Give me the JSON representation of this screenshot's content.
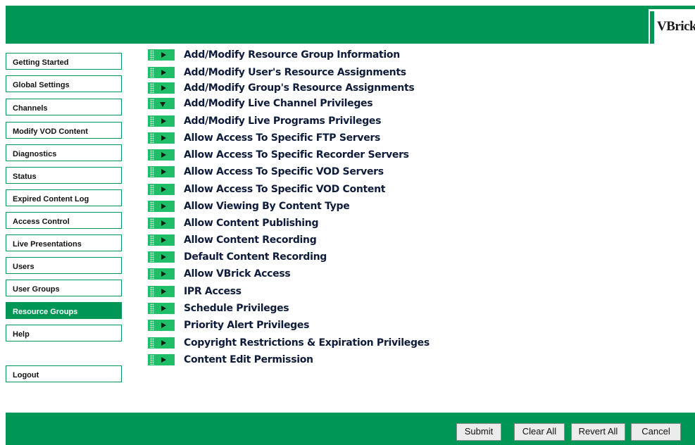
{
  "logo": {
    "text": "VBrick"
  },
  "sidebar": {
    "items": [
      {
        "label": "Getting Started"
      },
      {
        "label": "Global Settings"
      },
      {
        "label": "Channels"
      },
      {
        "label": "Modify VOD Content"
      },
      {
        "label": "Diagnostics"
      },
      {
        "label": "Status"
      },
      {
        "label": "Expired Content Log"
      },
      {
        "label": "Access Control"
      },
      {
        "label": "Live Presentations"
      },
      {
        "label": "Users"
      },
      {
        "label": "User Groups"
      },
      {
        "label": "Resource Groups",
        "active": true
      },
      {
        "label": "Help"
      }
    ],
    "logout": "Logout"
  },
  "main": {
    "items": [
      {
        "label": "Add/Modify Resource Group Information",
        "arrow": "right"
      },
      {
        "label": "Add/Modify User's Resource Assignments",
        "arrow": "right"
      },
      {
        "label": "Add/Modify Group's Resource Assignments",
        "arrow": "right"
      },
      {
        "label": "Add/Modify Live Channel Privileges",
        "arrow": "down"
      },
      {
        "label": "Add/Modify Live Programs Privileges",
        "arrow": "right"
      },
      {
        "label": "Allow Access To Specific FTP Servers",
        "arrow": "right"
      },
      {
        "label": "Allow Access To Specific Recorder Servers",
        "arrow": "right"
      },
      {
        "label": "Allow Access To Specific VOD Servers",
        "arrow": "right"
      },
      {
        "label": "Allow Access To Specific VOD Content",
        "arrow": "right"
      },
      {
        "label": "Allow Viewing By Content Type",
        "arrow": "right"
      },
      {
        "label": "Allow Content Publishing",
        "arrow": "right"
      },
      {
        "label": "Allow Content Recording",
        "arrow": "right"
      },
      {
        "label": "Default Content Recording",
        "arrow": "right"
      },
      {
        "label": "Allow VBrick Access",
        "arrow": "right"
      },
      {
        "label": "IPR Access",
        "arrow": "right"
      },
      {
        "label": "Schedule Privileges",
        "arrow": "right"
      },
      {
        "label": "Priority Alert Privileges",
        "arrow": "right"
      },
      {
        "label": "Copyright Restrictions & Expiration Privileges",
        "arrow": "right"
      },
      {
        "label": "Content Edit Permission",
        "arrow": "right"
      }
    ]
  },
  "footer": {
    "submit": "Submit",
    "clear_all": "Clear All",
    "revert_all": "Revert All",
    "cancel": "Cancel"
  },
  "colors": {
    "brand_green": "#009656",
    "arrow_green": "#1fbf6a"
  }
}
